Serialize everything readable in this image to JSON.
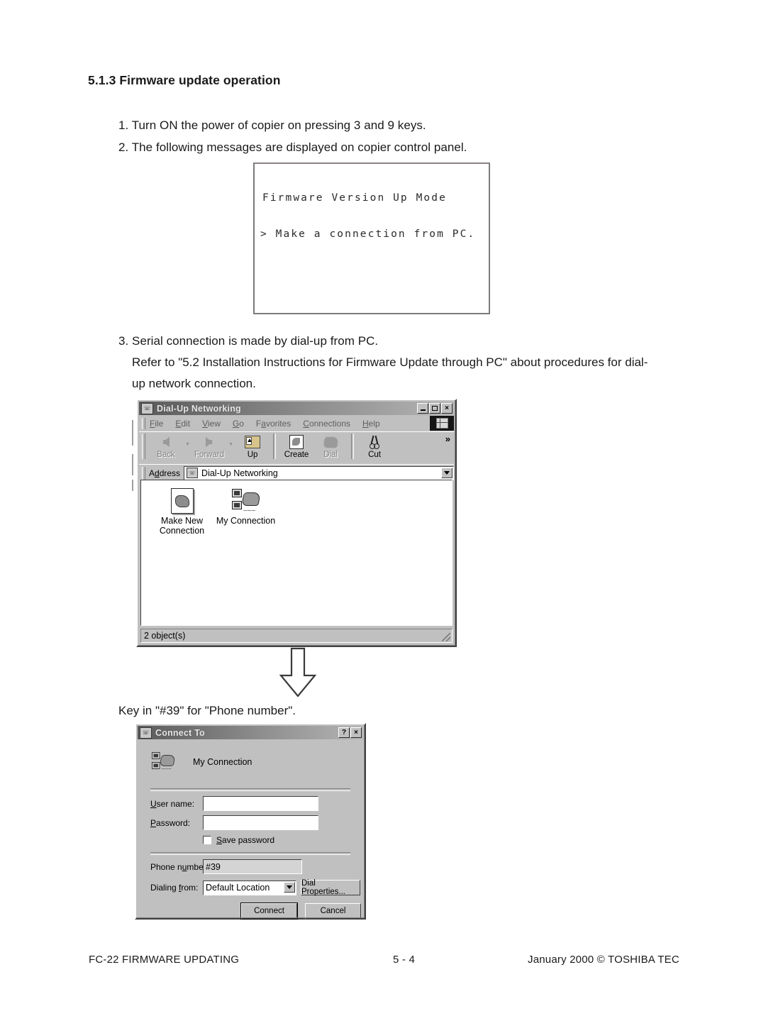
{
  "document": {
    "heading": "5.1.3 Firmware update operation",
    "steps": [
      "1. Turn ON the power of copier on pressing 3 and 9 keys.",
      "2. The following messages are displayed on copier control panel.",
      "3. Serial connection is made by dial-up from PC."
    ],
    "refer_line_1": "Refer to \"5.2 Installation Instructions for Firmware Update through PC\" about procedures for dial-",
    "refer_line_2": "up network connection.",
    "key_in_caption": "Key in \"#39\" for \"Phone number\"."
  },
  "lcd_panel": {
    "line_1": "Firmware Version Up Mode",
    "line_2": "> Make a connection from PC."
  },
  "dun_window": {
    "title": "Dial-Up Networking",
    "title_icon": "dial-up-networking-icon",
    "window_buttons": {
      "minimize": "minimize-icon",
      "maximize": "maximize-icon",
      "close": "×"
    },
    "menu": [
      {
        "label": "File",
        "accel": "F"
      },
      {
        "label": "Edit",
        "accel": "E"
      },
      {
        "label": "View",
        "accel": "V"
      },
      {
        "label": "Go",
        "accel": "G"
      },
      {
        "label": "Favorites",
        "accel": "a"
      },
      {
        "label": "Connections",
        "accel": "C"
      },
      {
        "label": "Help",
        "accel": "H"
      }
    ],
    "toolbar": [
      {
        "label": "Back",
        "icon": "back-arrow-icon",
        "disabled": true,
        "has_dropdown": true
      },
      {
        "label": "Forward",
        "icon": "forward-arrow-icon",
        "disabled": true,
        "has_dropdown": true
      },
      {
        "label": "Up",
        "icon": "folder-up-icon",
        "disabled": false
      },
      {
        "label": "Create",
        "icon": "create-connection-icon",
        "disabled": false
      },
      {
        "label": "Dial",
        "icon": "dial-modem-icon",
        "disabled": true
      },
      {
        "label": "Cut",
        "icon": "scissors-icon",
        "disabled": false
      }
    ],
    "toolbar_overflow": "»",
    "address": {
      "label": "Address",
      "value": "Dial-Up Networking",
      "icon": "dial-up-networking-icon"
    },
    "items": [
      {
        "label": "Make New\nConnection",
        "icon": "make-new-connection-icon"
      },
      {
        "label": "My Connection",
        "icon": "my-connection-icon"
      }
    ],
    "status": "2 object(s)"
  },
  "connect_dialog": {
    "title": "Connect To",
    "title_icon": "connect-to-icon",
    "help_button": "?",
    "close_button": "×",
    "connection_name": "My Connection",
    "connection_icon": "my-connection-icon",
    "fields": {
      "user_name_label": "User name:",
      "user_name_value": "",
      "password_label": "Password:",
      "password_value": "",
      "save_password_label": "Save password",
      "save_password_checked": false,
      "phone_number_label": "Phone number:",
      "phone_number_value": "#39",
      "dialing_from_label": "Dialing from:",
      "dialing_from_value": "Default Location",
      "dial_properties_label": "Dial Properties..."
    },
    "buttons": {
      "connect": "Connect",
      "cancel": "Cancel"
    }
  },
  "footer": {
    "left": "FC-22  FIRMWARE UPDATING",
    "center": "5 - 4",
    "right": "January 2000  ©  TOSHIBA TEC"
  },
  "colors": {
    "page_background": "#ffffff",
    "text": "#1a1a1a",
    "window_face": "#c0c0c0",
    "titlebar_dark": "#5a5a5a",
    "field_background": "#ffffff",
    "lcd_border": "#7b7b7b"
  }
}
